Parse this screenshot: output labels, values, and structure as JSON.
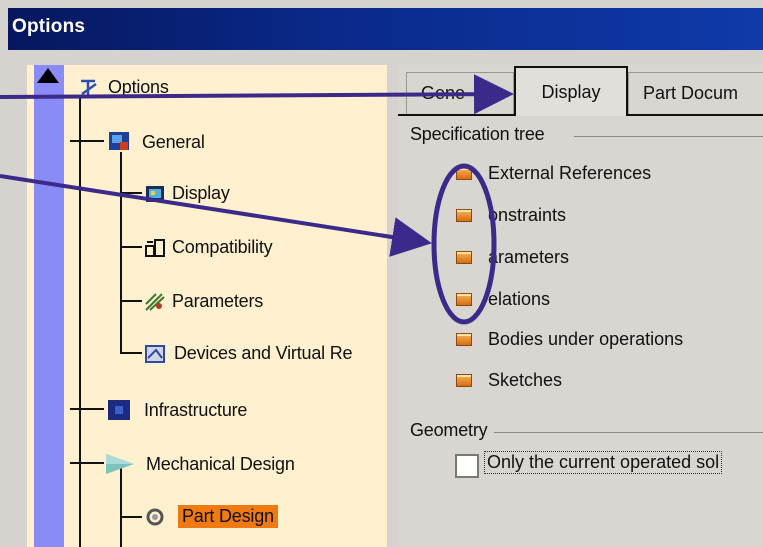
{
  "window": {
    "title": "Options"
  },
  "tree": {
    "root": "Options",
    "items": [
      {
        "label": "General",
        "icon": "general-icon"
      },
      {
        "label": "Display",
        "icon": "display-icon"
      },
      {
        "label": "Compatibility",
        "icon": "compatibility-icon"
      },
      {
        "label": "Parameters",
        "icon": "parameters-icon"
      },
      {
        "label": "Devices and Virtual Re",
        "icon": "devices-icon"
      },
      {
        "label": "Infrastructure",
        "icon": "infrastructure-icon"
      },
      {
        "label": "Mechanical Design",
        "icon": "mechanical-design-icon"
      },
      {
        "label": "Part Design",
        "icon": "part-design-icon"
      }
    ],
    "selected": "Part Design"
  },
  "tabs": [
    {
      "label": "Gene",
      "active": false
    },
    {
      "label": "Display",
      "active": true
    },
    {
      "label": "Part Docum",
      "active": false
    }
  ],
  "spec_tree": {
    "title": "Specification tree",
    "options": [
      "External References",
      "Constraints",
      "Parameters",
      "Relations",
      "Bodies under operations",
      "Sketches"
    ],
    "option_display": [
      "External References",
      "onstraints",
      "arameters",
      "elations",
      "Bodies under operations",
      "Sketches"
    ]
  },
  "geometry": {
    "title": "Geometry",
    "checkbox_label": "Only the current operated sol",
    "checked": false
  },
  "annotation": {
    "color": "#3b2a8a"
  }
}
